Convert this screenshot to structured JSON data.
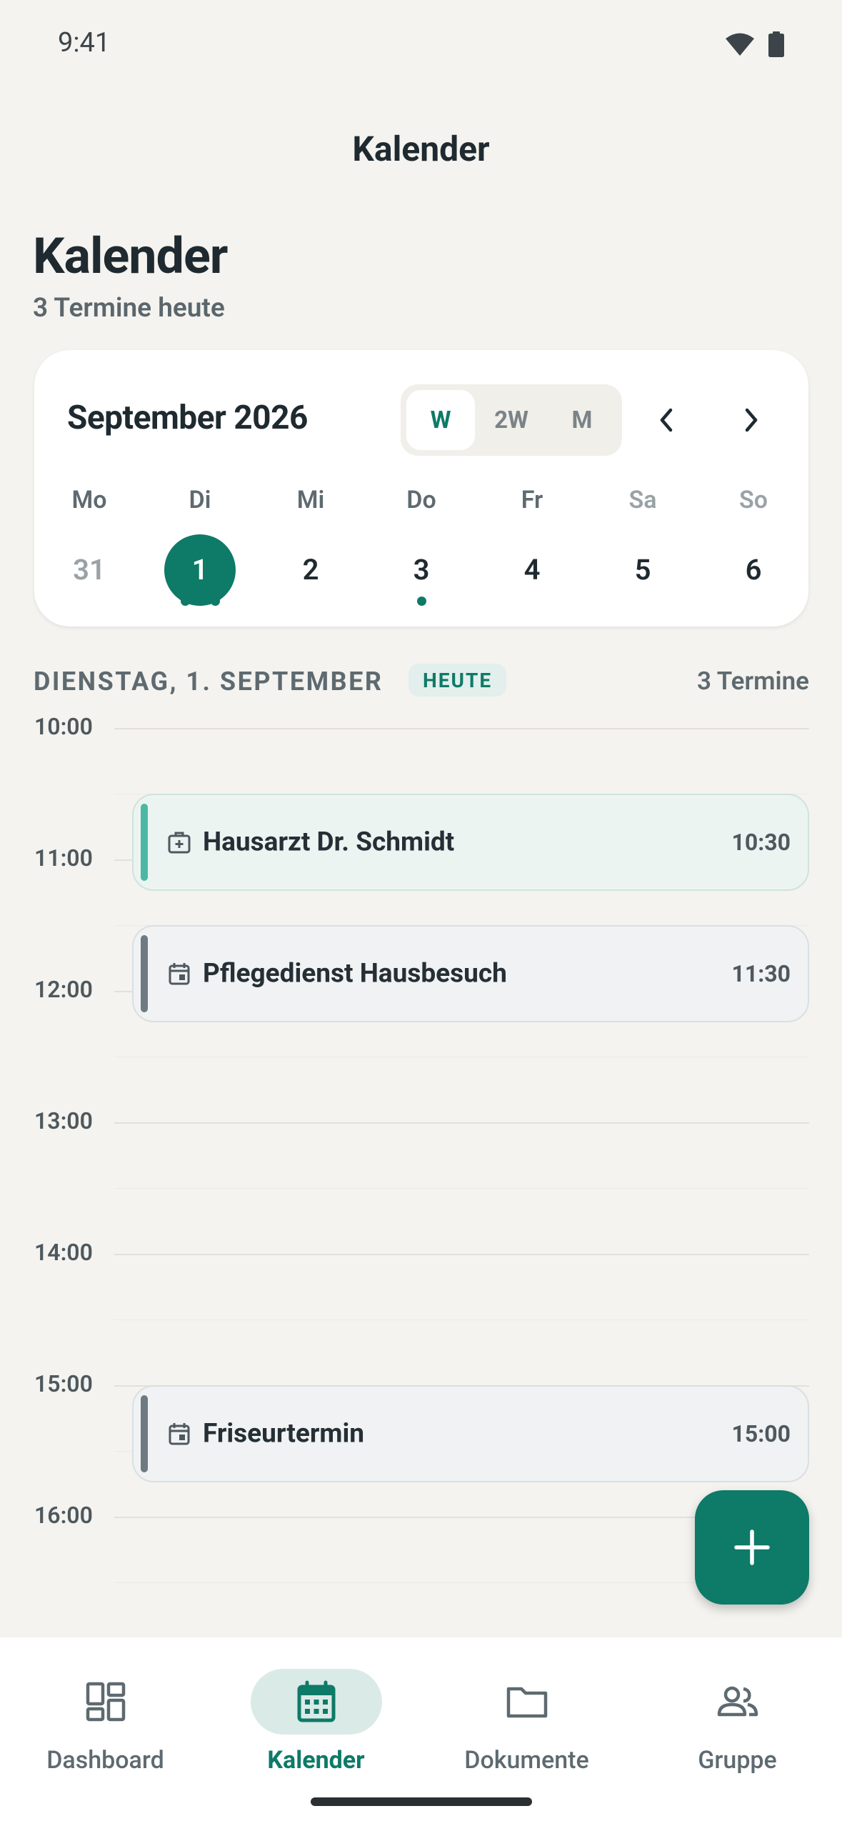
{
  "status_bar": {
    "time": "9:41",
    "icons": [
      "wifi-icon",
      "battery-icon"
    ]
  },
  "app_bar": {
    "title": "Kalender"
  },
  "header": {
    "title": "Kalender",
    "subtitle": "3 Termine heute"
  },
  "calendar": {
    "month_label": "September 2026",
    "view_options": [
      "W",
      "2W",
      "M"
    ],
    "active_view": "W",
    "weekdays": [
      "Mo",
      "Di",
      "Mi",
      "Do",
      "Fr",
      "Sa",
      "So"
    ],
    "days": [
      "31",
      "2",
      "3",
      "4",
      "5",
      "6"
    ],
    "selected_day": "1"
  },
  "agenda": {
    "date_label": "DIENSTAG, 1. SEPTEMBER",
    "today_badge": "HEUTE",
    "count_label": "3 Termine",
    "hours": [
      "10:00",
      "11:00",
      "12:00",
      "13:00",
      "14:00",
      "15:00",
      "16:00"
    ],
    "events": [
      {
        "title": "Hausarzt Dr. Schmidt",
        "time": "10:30",
        "icon": "medical-bag-icon",
        "category": "medical"
      },
      {
        "title": "Pflegedienst Hausbesuch",
        "time": "11:30",
        "icon": "calendar-event-icon",
        "category": "general"
      },
      {
        "title": "Friseurtermin",
        "time": "15:00",
        "icon": "calendar-event-icon",
        "category": "general"
      }
    ]
  },
  "fab": {
    "icon": "plus-icon"
  },
  "bottom_nav": {
    "items": [
      {
        "label": "Dashboard",
        "icon": "dashboard-icon"
      },
      {
        "label": "Kalender",
        "icon": "calendar-icon"
      },
      {
        "label": "Dokumente",
        "icon": "folder-icon"
      },
      {
        "label": "Gruppe",
        "icon": "group-icon"
      }
    ],
    "active": "Kalender"
  },
  "colors": {
    "accent": "#0E7A68",
    "background": "#F4F3EF",
    "medical": "#4CB8A3",
    "general": "#6E7A82"
  }
}
